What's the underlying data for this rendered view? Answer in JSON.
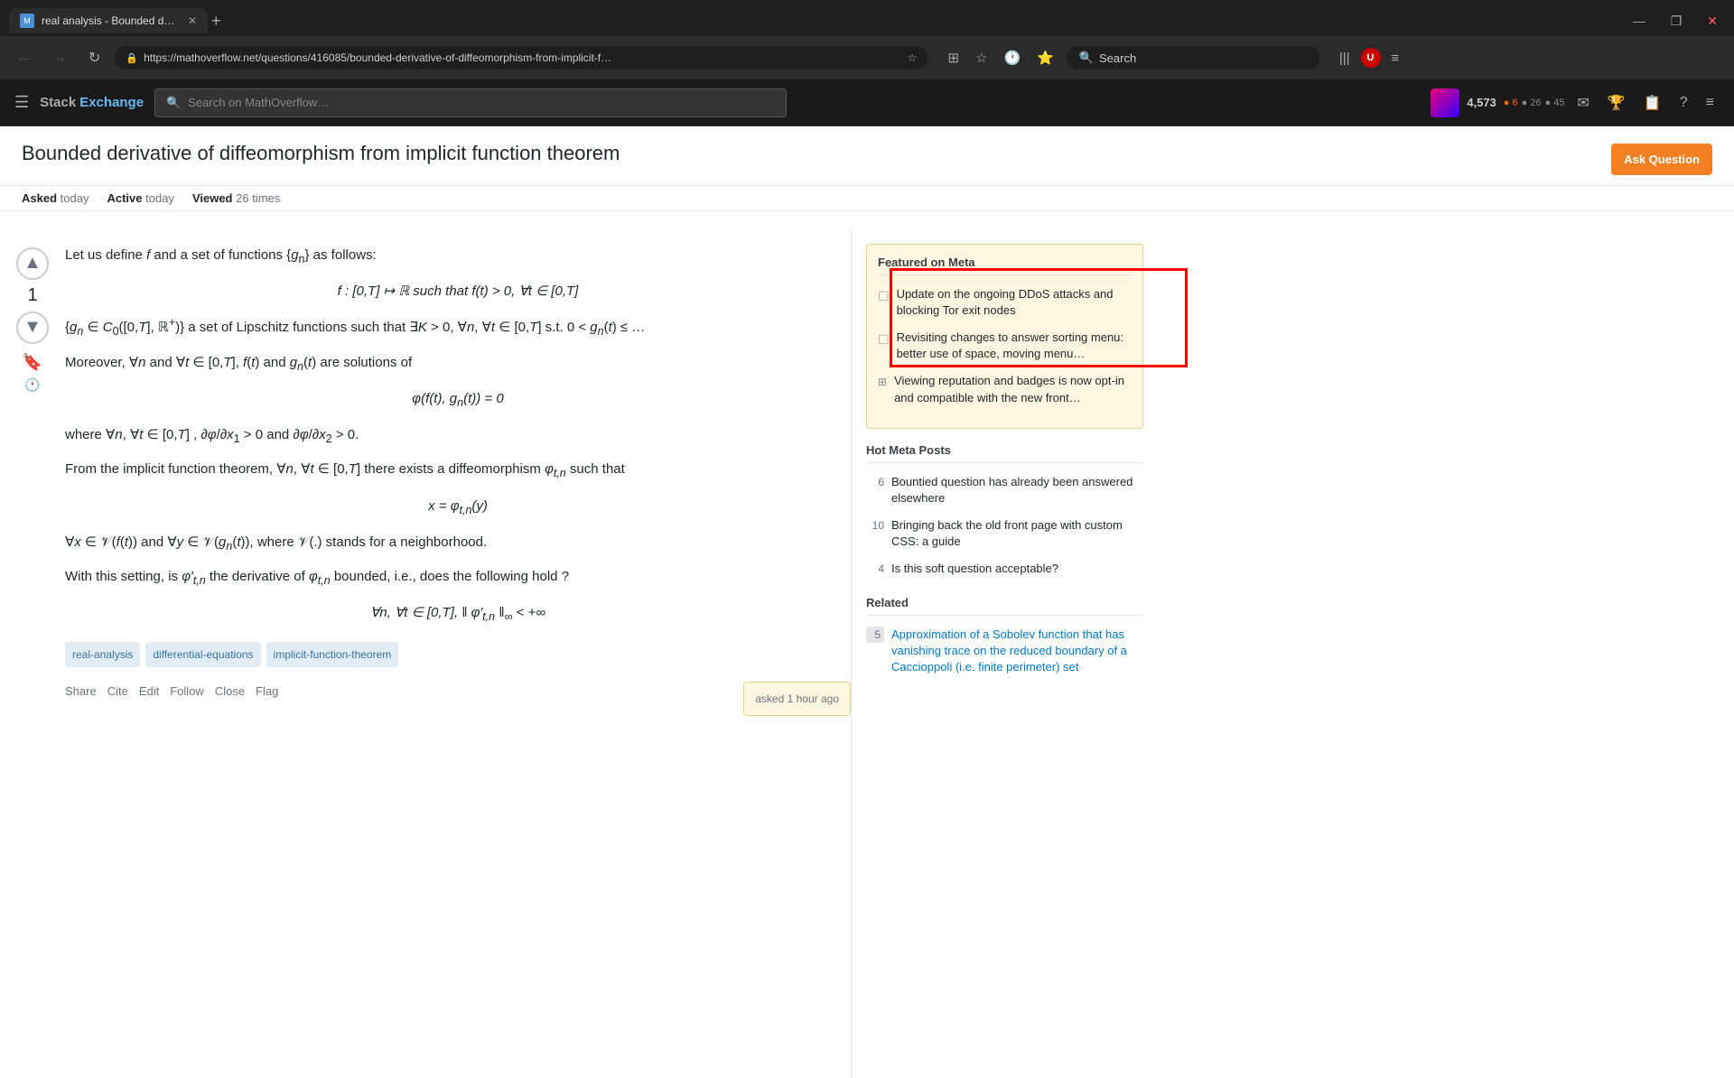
{
  "browser": {
    "tab_title": "real analysis - Bounded derivati…",
    "url": "https://mathoverflow.net/questions/416085/bounded-derivative-of-diffeomorphism-from-implicit-f…",
    "new_tab_label": "+",
    "search_label": "Search",
    "nav": {
      "back": "←",
      "forward": "→",
      "refresh": "↻"
    },
    "window_controls": {
      "minimize": "—",
      "restore": "❐",
      "close": "✕"
    }
  },
  "header": {
    "logo_stack": "Stack",
    "logo_exchange": "Exchange",
    "search_placeholder": "Search on MathOverflow…",
    "reputation": "4,573",
    "rep_dots": "● 6  ● 26  ● 45",
    "ask_question": "Ask Question"
  },
  "question": {
    "title": "Bounded derivative of diffeomorphism from implicit function theorem",
    "asked_label": "Asked",
    "asked_value": "today",
    "active_label": "Active",
    "active_value": "today",
    "viewed_label": "Viewed",
    "viewed_value": "26 times",
    "vote_count": "1",
    "body_paragraphs": [
      "Let us define f and a set of functions {gₙ} as follows:",
      "Moreover, ∀n and ∀t ∈ [0,T], f(t) and gₙ(t) are solutions of",
      "where ∀n, ∀t ∈ [0,T], ∂φ/∂x₁ > 0 and ∂φ/∂x₂ > 0.",
      "From the implicit function theorem, ∀n, ∀t ∈ [0,T] there exists a diffeomorphism φₜ,ₙ such that",
      "∀x ∈ 𝒱(f(t)) and ∀y ∈ 𝒱(gₙ(t)), where 𝒱(.) stands for a neighborhood.",
      "With this setting, is φ′ₜ,ₙ the derivative of φₜ,ₙ bounded, i.e., does the following hold ?"
    ],
    "math_1": "f : [0,T] ↦ ℝ such that f(t) > 0, ∀t ∈ [0,T]",
    "math_2": "{gₙ ∈ C₀([0,T], ℝ⁺)} a set of Lipschitz functions such that ∃K > 0, ∀n, ∀t ∈ [0,T] s.t. 0 < gₙ(t) ≤ …",
    "math_3": "φ(f(t), gₙ(t)) = 0",
    "math_4": "x = φₜ,ₙ(y)",
    "math_5": "∀n, ∀t ∈ [0,T], ‖ φ′ₜ,ₙ ‖∞ < +∞",
    "tags": [
      "real-analysis",
      "differential-equations",
      "implicit-function-theorem"
    ],
    "actions": [
      "Share",
      "Cite",
      "Edit",
      "Follow",
      "Close",
      "Flag"
    ],
    "asked_box_label": "asked 1 hour ago"
  },
  "featured_meta": {
    "section_title": "Featured on Meta",
    "items": [
      {
        "type": "checkbox",
        "text": "Update on the ongoing DDoS attacks and blocking Tor exit nodes"
      },
      {
        "type": "checkbox",
        "text": "Revisiting changes to answer sorting menu: better use of space, moving menu…"
      },
      {
        "type": "meta",
        "text": "Viewing reputation and badges is now opt-in and compatible with the new front…"
      }
    ]
  },
  "hot_meta": {
    "section_title": "Hot Meta Posts",
    "items": [
      {
        "count": "6",
        "text": "Bountied question has already been answered elsewhere"
      },
      {
        "count": "10",
        "text": "Bringing back the old front page with custom CSS: a guide"
      },
      {
        "count": "4",
        "text": "Is this soft question acceptable?"
      }
    ]
  },
  "related": {
    "section_title": "Related",
    "items": [
      {
        "count": "5",
        "text": "Approximation of a Sobolev function that has vanishing trace on the reduced boundary of a Caccioppoli (i.e. finite perimeter) set"
      }
    ]
  }
}
